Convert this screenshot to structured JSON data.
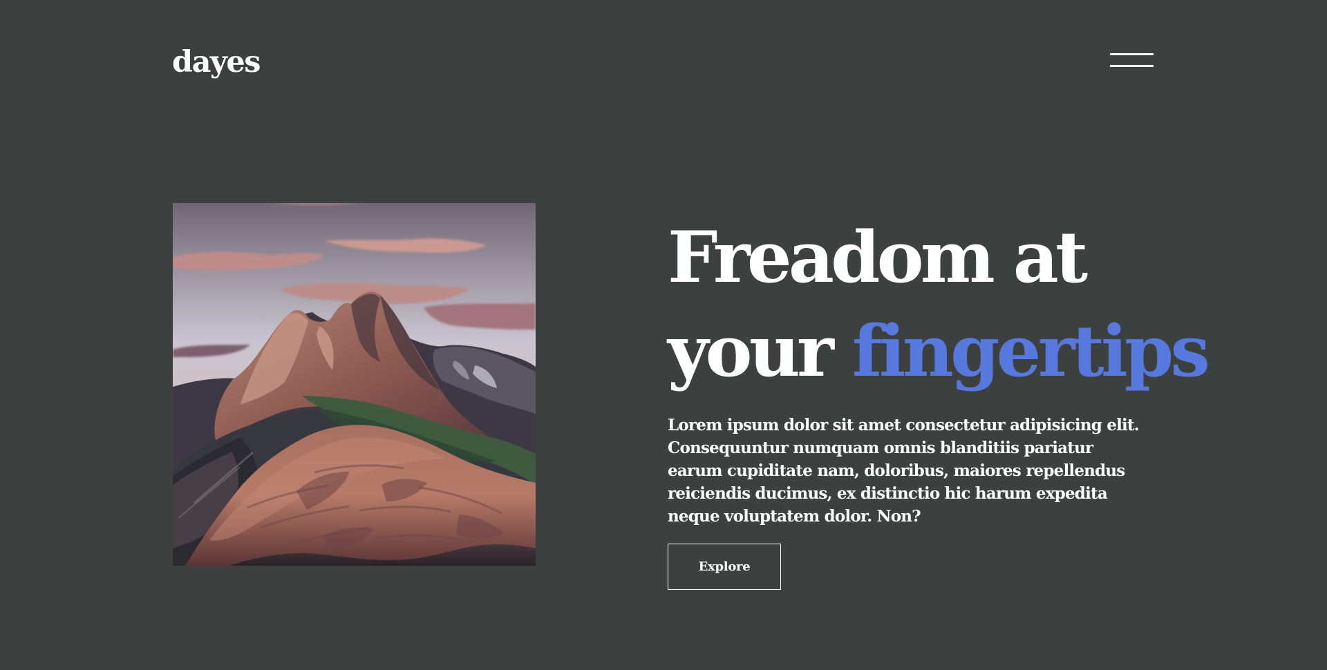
{
  "header": {
    "logo_text": "dayes",
    "menu_icon": "hamburger-menu-icon"
  },
  "hero": {
    "image_description": "",
    "headline_line1": "Freadom at",
    "headline_line2_plain": "your ",
    "headline_line2_highlight": "fingertips",
    "description": "Lorem ipsum dolor sit amet consectetur adipisicing elit. Consequuntur numquam omnis blanditiis pariatur earum cupiditate nam, doloribus, maiores repellendus reiciendis ducimus, ex distinctio hic harum expedita neque voluptatem dolor. Non?",
    "button_label": "Explore"
  },
  "colors": {
    "background": "#3c4140",
    "text": "#ffffff",
    "accent": "#5779dd"
  }
}
